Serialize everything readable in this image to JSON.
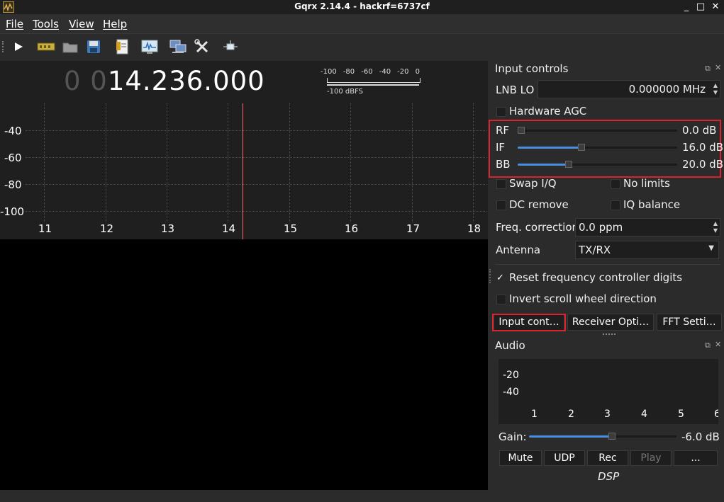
{
  "window": {
    "title": "Gqrx 2.14.4 - hackrf=6737cf",
    "controls": {
      "minimize": "_",
      "maximize": "□",
      "close": "✕"
    }
  },
  "menu": {
    "file": "File",
    "tools": "Tools",
    "view": "View",
    "help": "Help"
  },
  "toolbar": {
    "icons": [
      "play-icon",
      "hardware-icon",
      "open-folder-icon",
      "save-icon",
      "notes-icon",
      "spectrum-icon",
      "remote-control-icon",
      "settings-tools-icon",
      "center-icon"
    ]
  },
  "frequency": {
    "leading_dim": "0 0",
    "value": "14.236.000"
  },
  "signal_meter": {
    "scale": [
      "-100",
      "-80",
      "-60",
      "-40",
      "-20",
      "0"
    ],
    "label": "-100 dBFS"
  },
  "fft_plot": {
    "y_labels": [
      "-40",
      "-60",
      "-80",
      "-100"
    ],
    "x_labels": [
      "11",
      "12",
      "13",
      "14",
      "15",
      "16",
      "17",
      "18"
    ]
  },
  "input_controls": {
    "title": "Input controls",
    "lnb_lo": {
      "label": "LNB LO",
      "value": "0.000000 MHz"
    },
    "hardware_agc": {
      "label": "Hardware AGC",
      "checked": false
    },
    "gains": [
      {
        "name": "RF",
        "value": "0.0 dB",
        "level": 0.0
      },
      {
        "name": "IF",
        "value": "16.0 dB",
        "level": 0.4
      },
      {
        "name": "BB",
        "value": "20.0 dB",
        "level": 0.31
      }
    ],
    "swap_iq": {
      "label": "Swap I/Q",
      "checked": false
    },
    "no_limits": {
      "label": "No limits",
      "checked": false
    },
    "dc_remove": {
      "label": "DC remove",
      "checked": false
    },
    "iq_balance": {
      "label": "IQ balance",
      "checked": false
    },
    "freq_correction": {
      "label": "Freq. correction",
      "value": "0.0 ppm"
    },
    "antenna": {
      "label": "Antenna",
      "value": "TX/RX"
    },
    "reset_digits": {
      "label": "Reset frequency controller digits",
      "checked": true,
      "mark": "✓"
    },
    "invert_scroll": {
      "label": "Invert scroll wheel direction",
      "checked": false
    }
  },
  "tabs": [
    "Input cont…",
    "Receiver Opti…",
    "FFT Setti…"
  ],
  "audio": {
    "title": "Audio",
    "y_labels": [
      "-20",
      "-40"
    ],
    "x_labels": [
      "1",
      "2",
      "3",
      "4",
      "5",
      "6"
    ],
    "gain_label": "Gain:",
    "gain_value": "-6.0 dB",
    "gain_level": 0.56,
    "buttons": [
      "Mute",
      "UDP",
      "Rec",
      "Play",
      "..."
    ],
    "dsp_label": "DSP"
  },
  "colors": {
    "accent": "#4a90e2",
    "highlight": "#d9232e",
    "marker": "#ff6b6b"
  }
}
